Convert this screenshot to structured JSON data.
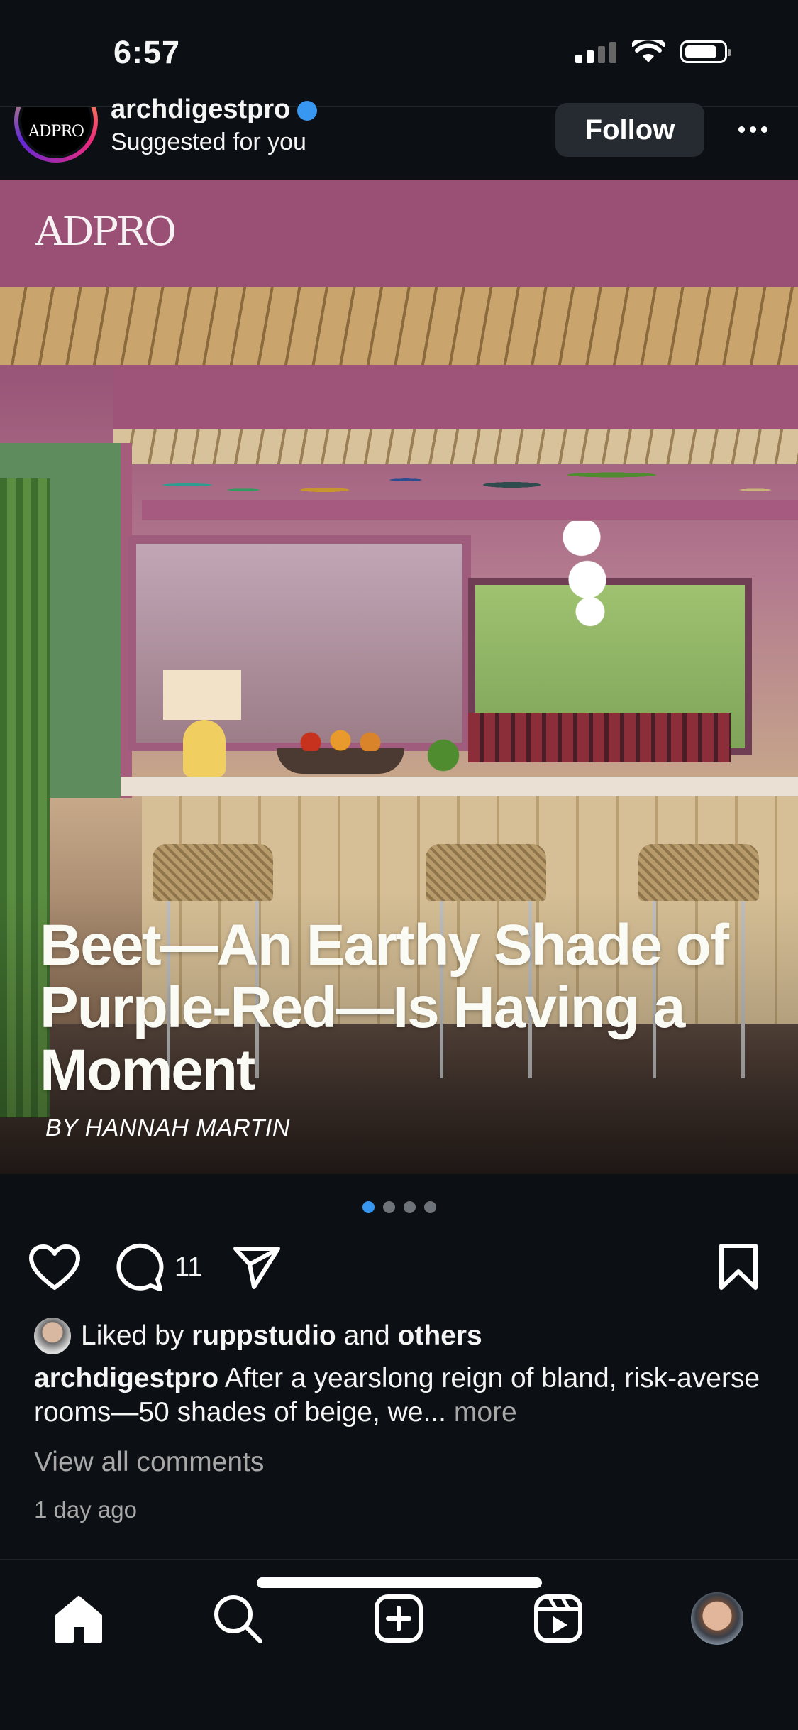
{
  "status_bar": {
    "time": "6:57"
  },
  "post": {
    "username": "archdigestpro",
    "subtitle": "Suggested for you",
    "avatar_text": "ADPRO",
    "follow_label": "Follow",
    "image": {
      "brand_logo_a": "AD",
      "brand_logo_b": "PRO",
      "headline": "Beet—An Earthy Shade of Purple-Red—Is Having a Moment",
      "byline": "BY HANNAH MARTIN"
    },
    "carousel": {
      "count": 4,
      "active_index": 0
    },
    "comment_count": "11",
    "liked_by": {
      "prefix": "Liked by",
      "user": "ruppstudio",
      "connector": "and",
      "others": "others"
    },
    "caption": {
      "user": "archdigestpro",
      "text": "After a yearslong reign of bland, risk-averse rooms—50 shades of beige, we...",
      "more": "more"
    },
    "view_comments": "View all comments",
    "time_ago": "1 day ago"
  },
  "nav": {
    "items": [
      "home-icon",
      "search-icon",
      "create-icon",
      "reels-icon",
      "profile-avatar"
    ]
  },
  "colors": {
    "background": "#0c1014",
    "accent_blue": "#3897f0",
    "muted_text": "#a8a8a8",
    "follow_button_bg": "#262b31"
  }
}
